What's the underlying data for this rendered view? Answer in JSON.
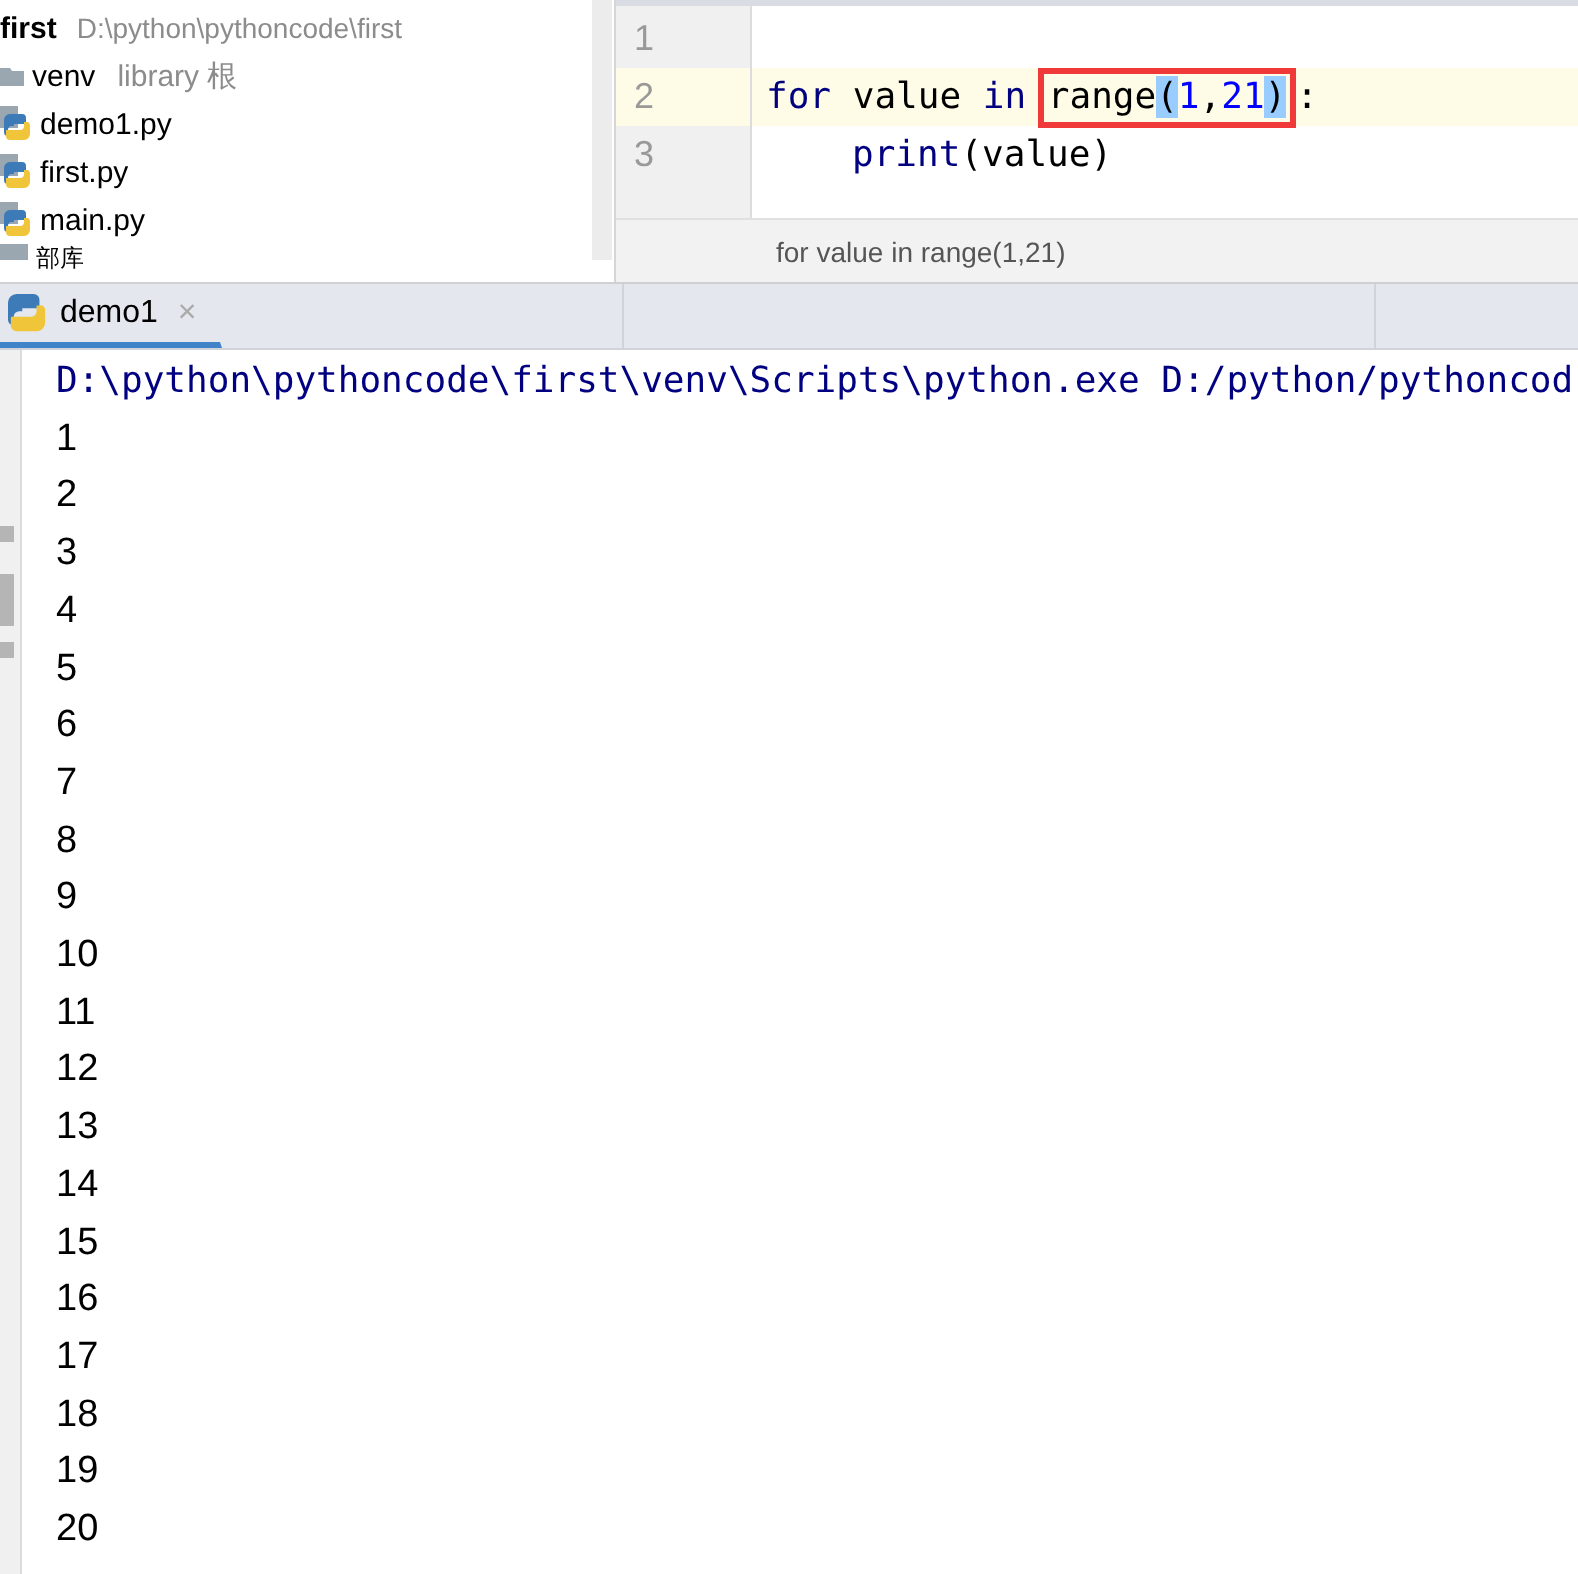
{
  "project": {
    "root": {
      "name": "first",
      "path": "D:\\python\\pythoncode\\first"
    },
    "items": [
      {
        "kind": "folder",
        "name": "venv",
        "note": "library 根"
      },
      {
        "kind": "python",
        "name": "demo1.py"
      },
      {
        "kind": "python",
        "name": "first.py"
      },
      {
        "kind": "python",
        "name": "main.py"
      },
      {
        "kind": "library",
        "name": "部库"
      }
    ]
  },
  "editor": {
    "lines": [
      {
        "number": "1",
        "current": false
      },
      {
        "number": "2",
        "current": true,
        "indented": false,
        "tokens": [
          {
            "kind": "keyword",
            "text": "for"
          },
          {
            "kind": "plain",
            "text": " value "
          },
          {
            "kind": "keyword",
            "text": "in "
          },
          {
            "kind": "box",
            "tokens": [
              {
                "kind": "plain",
                "text": "range"
              },
              {
                "kind": "brace",
                "text": "("
              },
              {
                "kind": "number",
                "text": "1"
              },
              {
                "kind": "plain",
                "text": ","
              },
              {
                "kind": "number",
                "text": "21"
              },
              {
                "kind": "brace",
                "text": ")"
              }
            ]
          },
          {
            "kind": "plain",
            "text": ":"
          }
        ]
      },
      {
        "number": "3",
        "current": false,
        "indented": true,
        "tokens": [
          {
            "kind": "builtin",
            "text": "print"
          },
          {
            "kind": "plain",
            "text": "(value)"
          }
        ]
      }
    ],
    "breadcrumb": "for value in range(1,21)"
  },
  "run": {
    "tabs": [
      {
        "label": "demo1",
        "close": "×",
        "selected": true
      }
    ],
    "command": "D:\\python\\pythoncode\\first\\venv\\Scripts\\python.exe D:/python/pythoncod",
    "output": [
      "1",
      "2",
      "3",
      "4",
      "5",
      "6",
      "7",
      "8",
      "9",
      "10",
      "11",
      "12",
      "13",
      "14",
      "15",
      "16",
      "17",
      "18",
      "19",
      "20"
    ]
  }
}
